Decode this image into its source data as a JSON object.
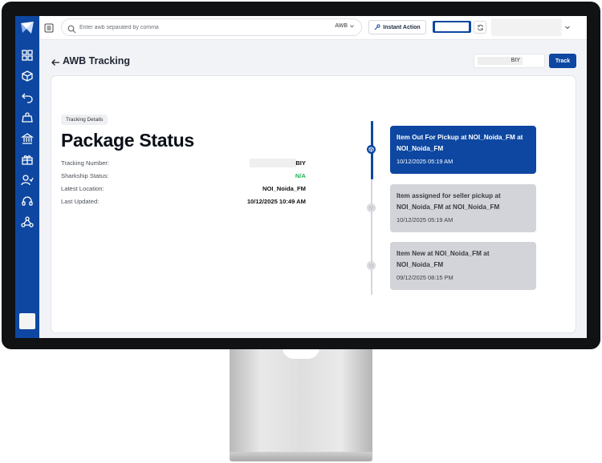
{
  "header": {
    "search_placeholder": "Enter awb separated by comma",
    "search_type": "AWB",
    "instant_action_label": "Instant Action"
  },
  "page": {
    "title": "AWB Tracking",
    "track_input_value": "BIY",
    "track_button": "Track"
  },
  "details": {
    "chip": "Tracking Details",
    "heading": "Package Status",
    "rows": [
      {
        "label": "Tracking Number:",
        "value": "BIY"
      },
      {
        "label": "Sharkship Status:",
        "value": "N/A"
      },
      {
        "label": "Latest Location:",
        "value": "NOI_Noida_FM"
      },
      {
        "label": "Last Updated:",
        "value": "10/12/2025 10:49 AM"
      }
    ]
  },
  "timeline": [
    {
      "title": "Item Out For Pickup at NOI_Noida_FM at NOI_Noida_FM",
      "time": "10/12/2025 05:19 AM",
      "active": true
    },
    {
      "title": "Item assigned for seller pickup at NOI_Noida_FM at NOI_Noida_FM",
      "time": "10/12/2025 05:19 AM",
      "active": false
    },
    {
      "title": "Item New at NOI_Noida_FM at NOI_Noida_FM",
      "time": "09/12/2025 08:15 PM",
      "active": false
    }
  ],
  "colors": {
    "brand": "#0d47a1",
    "status_green": "#22b356",
    "timeline_idle": "#d2d4d9"
  },
  "icons": {
    "sidebar": [
      "dashboard-icon",
      "package-icon",
      "return-icon",
      "bag-icon",
      "bank-icon",
      "gift-icon",
      "users-icon",
      "headset-icon",
      "webhook-icon"
    ]
  }
}
